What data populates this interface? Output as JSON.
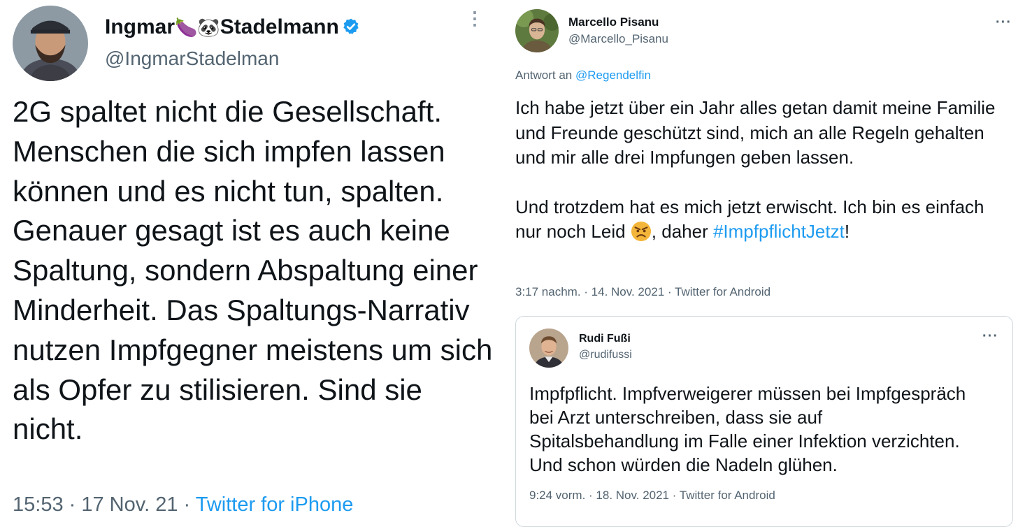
{
  "left_tweet": {
    "name_part1": "Ingmar",
    "name_emojis": "🍆🐼",
    "name_part2": "Stadelmann",
    "handle": "@IngmarStadelman",
    "more": "⋮",
    "body": "2G spaltet nicht die Gesellschaft. Menschen die sich impfen lassen können und es nicht tun, spalten. Genauer gesagt ist es auch keine Spaltung, sondern Abspaltung einer Minderheit. Das Spaltungs-Narrativ nutzen Impfgegner meistens um sich als Opfer zu stilisieren. Sind sie nicht.",
    "time": "15:53 · 17 Nov. 21 · ",
    "source": "Twitter for iPhone",
    "colors": {
      "verified": "#1d9bf0",
      "link": "#1d9bf0"
    }
  },
  "right_tweet": {
    "name": "Marcello Pisanu",
    "handle": "@Marcello_Pisanu",
    "more": "···",
    "reply_prefix": "Antwort an ",
    "reply_to": "@Regendelfin",
    "body_p1": "Ich habe jetzt über ein Jahr alles getan damit meine Familie und Freunde geschützt sind, mich an alle Regeln gehalten und mir alle drei Impfungen geben lassen.",
    "body_p2_before": "Und trotzdem hat es mich jetzt erwischt. Ich bin es einfach nur noch Leid ",
    "body_p2_middle": ", daher ",
    "hashtag": "#ImpfpflichtJetzt",
    "body_p2_end": "!",
    "emoji_icon": "angry-face-icon",
    "meta": "3:17 nachm. · 14. Nov. 2021 · Twitter for Android",
    "quoted_tweet": {
      "name": "Rudi Fußi",
      "handle": "@rudifussi",
      "more": "···",
      "body_lines": [
        "Impfpflicht. Impfverweigerer müssen bei Impfgespräch",
        "bei Arzt unterschreiben, dass sie auf",
        "Spitalsbehandlung im Falle einer Infektion verzichten.",
        "Und schon würden die Nadeln glühen."
      ],
      "meta": "9:24 vorm. · 18. Nov. 2021 · Twitter for Android"
    }
  }
}
